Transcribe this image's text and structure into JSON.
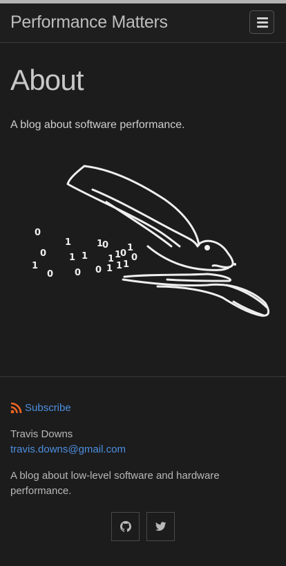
{
  "header": {
    "site_title": "Performance Matters",
    "menu_icon": "hamburger-menu-icon"
  },
  "main": {
    "title": "About",
    "intro": "A blog about software performance.",
    "hero_image": "rabbit-running-with-binary-digits-illustration"
  },
  "footer": {
    "subscribe_label": "Subscribe",
    "subscribe_icon": "rss-icon",
    "author_name": "Travis Downs",
    "email": "travis.downs@gmail.com",
    "description": "A blog about low-level software and hardware performance.",
    "social": [
      {
        "name": "github",
        "icon": "github-icon"
      },
      {
        "name": "twitter",
        "icon": "twitter-icon"
      }
    ]
  },
  "colors": {
    "background": "#1c1c1c",
    "link": "#4d8fe0",
    "rss": "#f26522",
    "text": "#c8c8c8"
  }
}
